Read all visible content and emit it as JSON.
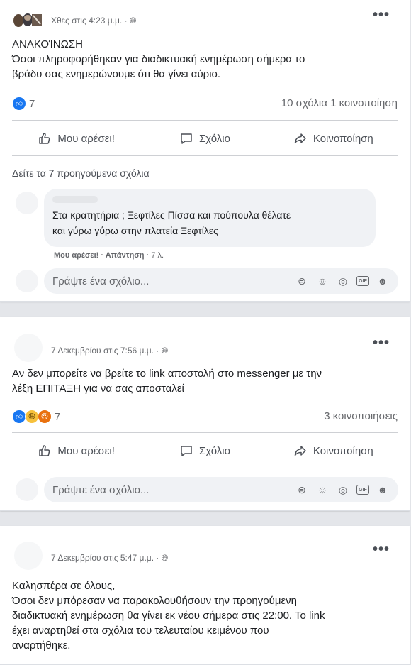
{
  "posts": [
    {
      "meta": "Χθες στις 4:23 μ.μ. ·",
      "text_lines": [
        "ΑΝΑΚΟΊΝΩΣΗ",
        "Όσοι πληροφορήθηκαν για διαδικτυακή ενημέρωση σήμερα το",
        "βράδυ σας ενημερώνουμε ότι θα γίνει αύριο."
      ],
      "reaction_count": "7",
      "counts": "10 σχόλια  1 κοινοποίηση",
      "actions": {
        "like": "Μου αρέσει!",
        "comment": "Σχόλιο",
        "share": "Κοινοποίηση"
      },
      "previous_comments": "Δείτε τα 7 προηγούμενα σχόλια",
      "comment": {
        "lines": [
          "Στα κρατητήρια ; Ξεφτίλες Πίσσα και πούπουλα θέλατε",
          "και γύρω γύρω στην πλατεία Ξεφτίλες"
        ],
        "like": "Μου αρέσει!",
        "reply": "Απάντηση",
        "time": "7 λ."
      },
      "composer_placeholder": "Γράψτε ένα σχόλιο..."
    },
    {
      "meta": "7 Δεκεμβρίου στις 7:56 μ.μ. ·",
      "text_lines": [
        "Αν δεν μπορείτε να βρείτε το link αποστολή στο messenger με την",
        "λέξη ΕΠΙΤΑΞΗ για να σας αποσταλεί"
      ],
      "reaction_count": "7",
      "counts": "3 κοινοποιήσεις",
      "actions": {
        "like": "Μου αρέσει!",
        "comment": "Σχόλιο",
        "share": "Κοινοποίηση"
      },
      "composer_placeholder": "Γράψτε ένα σχόλιο..."
    },
    {
      "meta": "7 Δεκεμβρίου στις 5:47 μ.μ. ·",
      "text_lines": [
        "Καλησπέρα σε όλους,",
        "Όσοι δεν μπόρεσαν να παρακολουθήσουν την προηγούμενη",
        "διαδικτυακή ενημέρωση θα γίνει εκ νέου σήμερα στις 22:00. Το link",
        "έχει αναρτηθεί στα σχόλια του τελευταίου κειμένου που",
        "αναρτήθηκε."
      ]
    }
  ],
  "more_options": "•••",
  "colors": {
    "like_blue": "#1877f2",
    "text": "#1c1e21",
    "secondary": "#65676b",
    "surface": "#f0f2f5"
  },
  "icons": [
    "globe-icon",
    "thumbs-up-icon",
    "comment-icon",
    "share-icon",
    "sticker-icon",
    "emoji-icon",
    "camera-icon",
    "gif-icon",
    "sticker-face-icon"
  ]
}
